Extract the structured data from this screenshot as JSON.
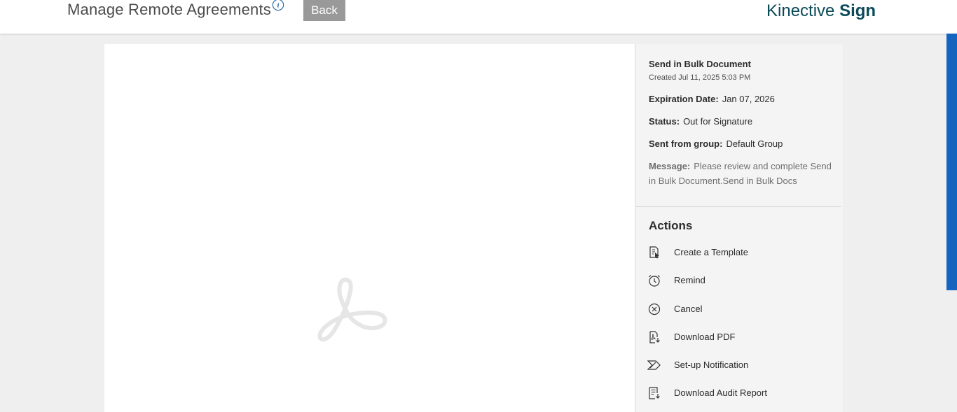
{
  "header": {
    "title": "Manage Remote Agreements",
    "back_label": "Back",
    "brand_part1": "Kinective",
    "brand_part2": "Sign"
  },
  "agreement": {
    "name": "Send in Bulk Document",
    "created": "Created Jul 11, 2025 5:03 PM",
    "expiration_label": "Expiration Date:",
    "expiration_value": "Jan 07, 2026",
    "status_label": "Status:",
    "status_value": "Out for Signature",
    "group_label": "Sent from group:",
    "group_value": "Default Group",
    "message_label": "Message:",
    "message_value": "Please review and complete Send in Bulk Document.Send in Bulk Docs"
  },
  "actions": {
    "title": "Actions",
    "items": [
      {
        "label": "Create a Template",
        "icon": "template-icon"
      },
      {
        "label": "Remind",
        "icon": "alarm-clock-icon"
      },
      {
        "label": "Cancel",
        "icon": "cancel-circle-icon"
      },
      {
        "label": "Download PDF",
        "icon": "download-pdf-icon"
      },
      {
        "label": "Set-up Notification",
        "icon": "notification-icon"
      },
      {
        "label": "Download Audit Report",
        "icon": "audit-report-icon"
      }
    ]
  },
  "colors": {
    "brand": "#0b4a59",
    "back_button": "#999999",
    "scrollbar": "#1565c0"
  }
}
